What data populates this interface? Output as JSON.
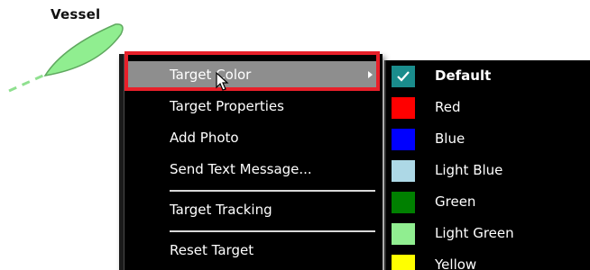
{
  "vessel": {
    "label": "Vessel"
  },
  "context_menu": {
    "items": [
      {
        "label": "Target Color"
      },
      {
        "label": "Target Properties"
      },
      {
        "label": "Add Photo"
      },
      {
        "label": "Send Text Message..."
      },
      {
        "label": "Target Tracking"
      },
      {
        "label": "Reset Target"
      }
    ],
    "active_item": "Target Color"
  },
  "color_submenu": {
    "items": [
      {
        "label": "Default",
        "color": "#1a8c8c",
        "selected": true
      },
      {
        "label": "Red",
        "color": "#ff0000",
        "selected": false
      },
      {
        "label": "Blue",
        "color": "#0000ff",
        "selected": false
      },
      {
        "label": "Light Blue",
        "color": "#add8e6",
        "selected": false
      },
      {
        "label": "Green",
        "color": "#008000",
        "selected": false
      },
      {
        "label": "Light Green",
        "color": "#90ee90",
        "selected": false
      },
      {
        "label": "Yellow",
        "color": "#ffff00",
        "selected": false
      }
    ]
  },
  "colors": {
    "menu_background": "#000000",
    "active_item_background": "#8e8e8e",
    "highlight_border": "#e8202a",
    "vessel_fill": "#90ee90"
  }
}
